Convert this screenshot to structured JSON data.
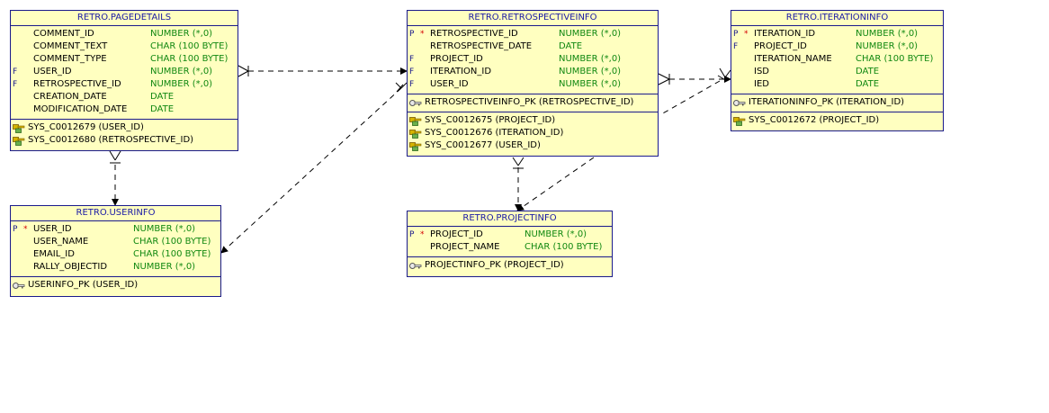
{
  "tables": {
    "pagedetails": {
      "title": "RETRO.PAGEDETAILS",
      "columns": [
        {
          "flag": "",
          "req": "",
          "name": "COMMENT_ID",
          "type": "NUMBER (*,0)"
        },
        {
          "flag": "",
          "req": "",
          "name": "COMMENT_TEXT",
          "type": "CHAR (100 BYTE)"
        },
        {
          "flag": "",
          "req": "",
          "name": "COMMENT_TYPE",
          "type": "CHAR (100 BYTE)"
        },
        {
          "flag": "F",
          "req": "",
          "name": "USER_ID",
          "type": "NUMBER (*,0)"
        },
        {
          "flag": "F",
          "req": "",
          "name": "RETROSPECTIVE_ID",
          "type": "NUMBER (*,0)"
        },
        {
          "flag": "",
          "req": "",
          "name": "CREATION_DATE",
          "type": "DATE"
        },
        {
          "flag": "",
          "req": "",
          "name": "MODIFICATION_DATE",
          "type": "DATE"
        }
      ],
      "pk": [],
      "fks": [
        {
          "label": "SYS_C0012679 (USER_ID)"
        },
        {
          "label": "SYS_C0012680 (RETROSPECTIVE_ID)"
        }
      ]
    },
    "retrospectiveinfo": {
      "title": "RETRO.RETROSPECTIVEINFO",
      "columns": [
        {
          "flag": "P",
          "req": "*",
          "name": "RETROSPECTIVE_ID",
          "type": "NUMBER (*,0)"
        },
        {
          "flag": "",
          "req": "",
          "name": "RETROSPECTIVE_DATE",
          "type": "DATE"
        },
        {
          "flag": "F",
          "req": "",
          "name": "PROJECT_ID",
          "type": "NUMBER (*,0)"
        },
        {
          "flag": "F",
          "req": "",
          "name": "ITERATION_ID",
          "type": "NUMBER (*,0)"
        },
        {
          "flag": "F",
          "req": "",
          "name": "USER_ID",
          "type": "NUMBER (*,0)"
        }
      ],
      "pk": [
        {
          "label": "RETROSPECTIVEINFO_PK (RETROSPECTIVE_ID)"
        }
      ],
      "fks": [
        {
          "label": "SYS_C0012675 (PROJECT_ID)"
        },
        {
          "label": "SYS_C0012676 (ITERATION_ID)"
        },
        {
          "label": "SYS_C0012677 (USER_ID)"
        }
      ]
    },
    "iterationinfo": {
      "title": "RETRO.ITERATIONINFO",
      "columns": [
        {
          "flag": "P",
          "req": "*",
          "name": "ITERATION_ID",
          "type": "NUMBER (*,0)"
        },
        {
          "flag": "F",
          "req": "",
          "name": "PROJECT_ID",
          "type": "NUMBER (*,0)"
        },
        {
          "flag": "",
          "req": "",
          "name": "ITERATION_NAME",
          "type": "CHAR (100 BYTE)"
        },
        {
          "flag": "",
          "req": "",
          "name": "ISD",
          "type": "DATE"
        },
        {
          "flag": "",
          "req": "",
          "name": "IED",
          "type": "DATE"
        }
      ],
      "pk": [
        {
          "label": "ITERATIONINFO_PK (ITERATION_ID)"
        }
      ],
      "fks": [
        {
          "label": "SYS_C0012672 (PROJECT_ID)"
        }
      ]
    },
    "userinfo": {
      "title": "RETRO.USERINFO",
      "columns": [
        {
          "flag": "P",
          "req": "*",
          "name": "USER_ID",
          "type": "NUMBER (*,0)"
        },
        {
          "flag": "",
          "req": "",
          "name": "USER_NAME",
          "type": "CHAR (100 BYTE)"
        },
        {
          "flag": "",
          "req": "",
          "name": "EMAIL_ID",
          "type": "CHAR (100 BYTE)"
        },
        {
          "flag": "",
          "req": "",
          "name": "RALLY_OBJECTID",
          "type": "NUMBER (*,0)"
        }
      ],
      "pk": [
        {
          "label": "USERINFO_PK (USER_ID)"
        }
      ],
      "fks": []
    },
    "projectinfo": {
      "title": "RETRO.PROJECTINFO",
      "columns": [
        {
          "flag": "P",
          "req": "*",
          "name": "PROJECT_ID",
          "type": "NUMBER (*,0)"
        },
        {
          "flag": "",
          "req": "",
          "name": "PROJECT_NAME",
          "type": "CHAR (100 BYTE)"
        }
      ],
      "pk": [
        {
          "label": "PROJECTINFO_PK (PROJECT_ID)"
        }
      ],
      "fks": []
    }
  },
  "colors": {
    "table_bg": "#ffffc0",
    "border": "#1a1a8c",
    "title": "#1a1aa6",
    "type": "#118811",
    "required": "#d40000",
    "connector": "#000000"
  },
  "icons": {
    "pk": "pk-key-icon",
    "fk": "fk-key-icon"
  }
}
